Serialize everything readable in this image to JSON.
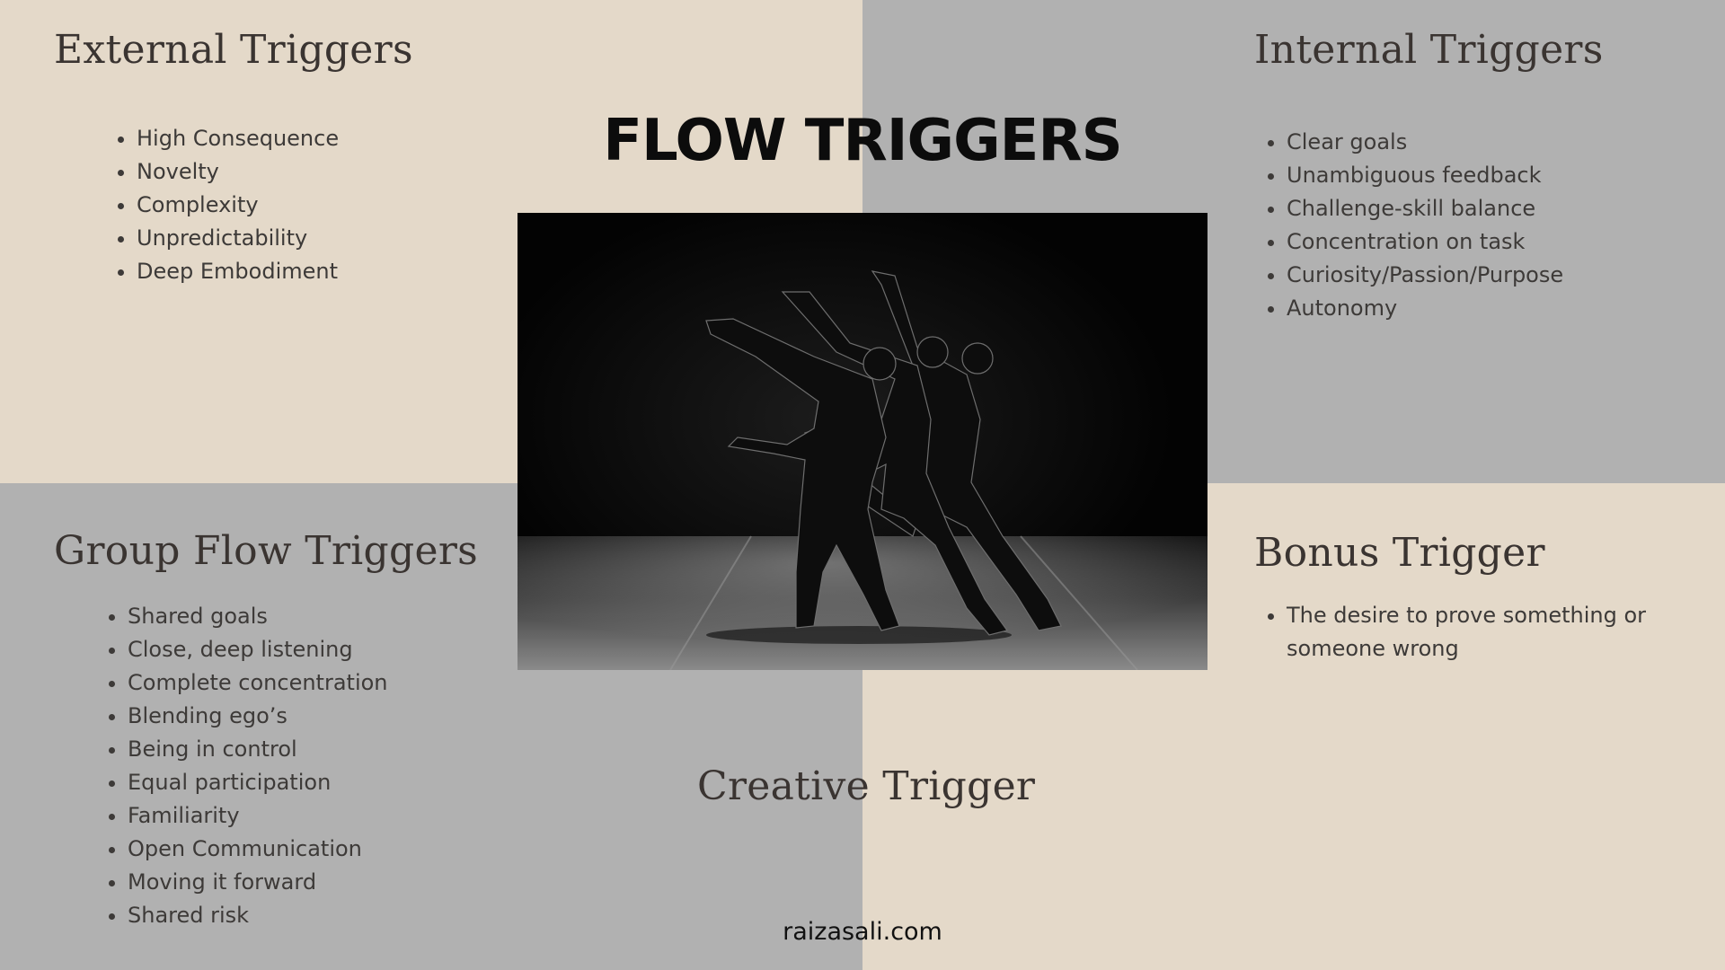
{
  "title": "FLOW TRIGGERS",
  "external": {
    "heading": "External Triggers",
    "items": [
      "High Consequence",
      "Novelty",
      "Complexity",
      "Unpredictability",
      "Deep Embodiment"
    ]
  },
  "internal": {
    "heading": "Internal Triggers",
    "items": [
      "Clear goals",
      "Unambiguous feedback",
      "Challenge-skill balance",
      "Concentration on task",
      "Curiosity/Passion/Purpose",
      "Autonomy"
    ]
  },
  "group": {
    "heading": "Group Flow Triggers",
    "items": [
      "Shared goals",
      "Close, deep listening",
      "Complete concentration",
      "Blending ego’s",
      "Being in control",
      "Equal participation",
      "Familiarity",
      "Open Communication",
      "Moving it forward",
      "Shared risk"
    ]
  },
  "bonus": {
    "heading": "Bonus Trigger",
    "items": [
      "The desire to prove something or someone wrong"
    ]
  },
  "creative": {
    "heading": "Creative Trigger"
  },
  "footer": {
    "website": "raizasali.com"
  },
  "colors": {
    "beige": "#e4d9c9",
    "gray": "#b1b1b1",
    "text": "#3a3431"
  }
}
